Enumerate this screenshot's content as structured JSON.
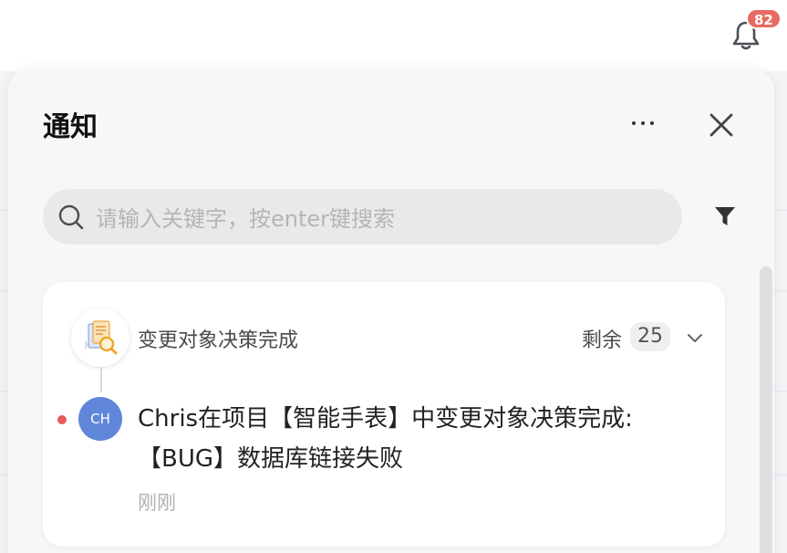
{
  "header": {
    "notification_badge": "82"
  },
  "panel": {
    "title": "通知",
    "search": {
      "placeholder": "请输入关键字，按enter键搜索"
    }
  },
  "group": {
    "title": "变更对象决策完成",
    "remaining_label": "剩余",
    "remaining_count": "25",
    "notification": {
      "avatar_initials": "CH",
      "message": "Chris在项目【智能手表】中变更对象决策完成:【BUG】数据库链接失败",
      "time": "刚刚",
      "unread": true
    }
  },
  "icons": {
    "bell": "bell-icon",
    "more": "more-icon",
    "close": "close-icon",
    "search": "search-icon",
    "filter": "filter-icon",
    "group": "document-search-icon",
    "expand": "chevron-down-icon"
  },
  "colors": {
    "badge": "#e86a62",
    "avatar": "#5f86d9",
    "unread_dot": "#ea5a5a"
  }
}
